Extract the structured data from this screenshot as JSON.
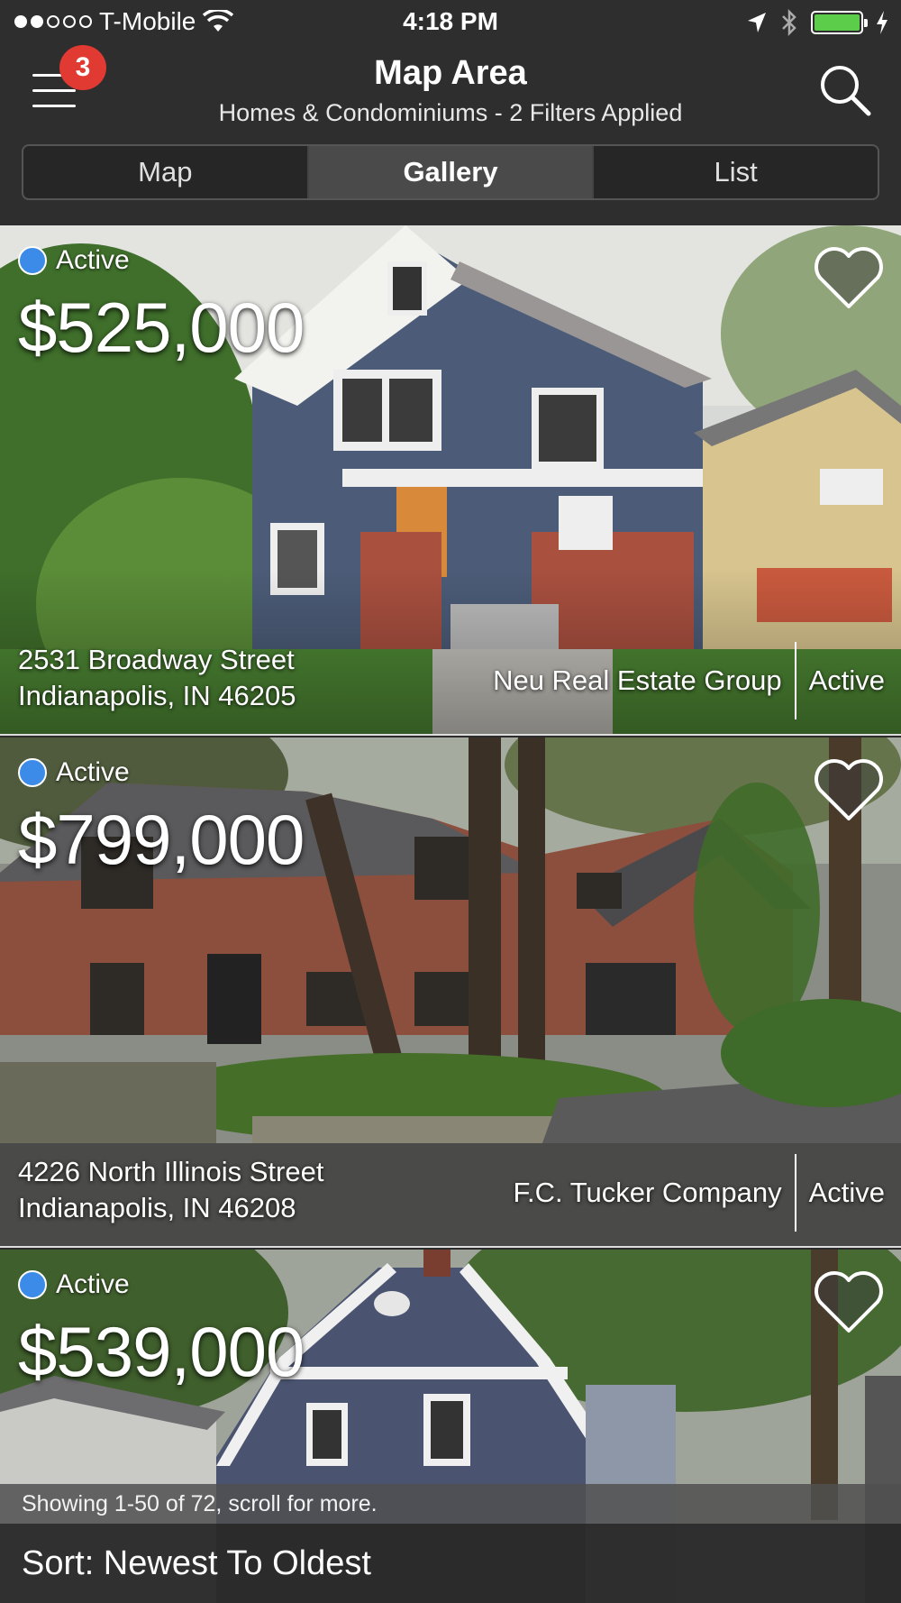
{
  "status_bar": {
    "carrier": "T-Mobile",
    "time": "4:18 PM"
  },
  "header": {
    "menu_badge": "3",
    "title": "Map Area",
    "subtitle": "Homes & Condominiums - 2 Filters Applied"
  },
  "tabs": [
    {
      "label": "Map",
      "selected": false
    },
    {
      "label": "Gallery",
      "selected": true
    },
    {
      "label": "List",
      "selected": false
    }
  ],
  "listings": [
    {
      "status": "Active",
      "price": "$525,000",
      "street": "2531 Broadway Street",
      "city": "Indianapolis, IN 46205",
      "agency": "Neu Real Estate Group",
      "agency_status": "Active"
    },
    {
      "status": "Active",
      "price": "$799,000",
      "street": "4226 North Illinois Street",
      "city": "Indianapolis, IN 46208",
      "agency": "F.C. Tucker Company",
      "agency_status": "Active"
    },
    {
      "status": "Active",
      "price": "$539,000"
    }
  ],
  "footer": {
    "showing": "Showing 1-50 of 72, scroll for more.",
    "sort": "Sort: Newest To Oldest"
  },
  "colors": {
    "status_dot": "#3d8be8",
    "badge": "#e13a32",
    "battery": "#5ccd4a"
  }
}
